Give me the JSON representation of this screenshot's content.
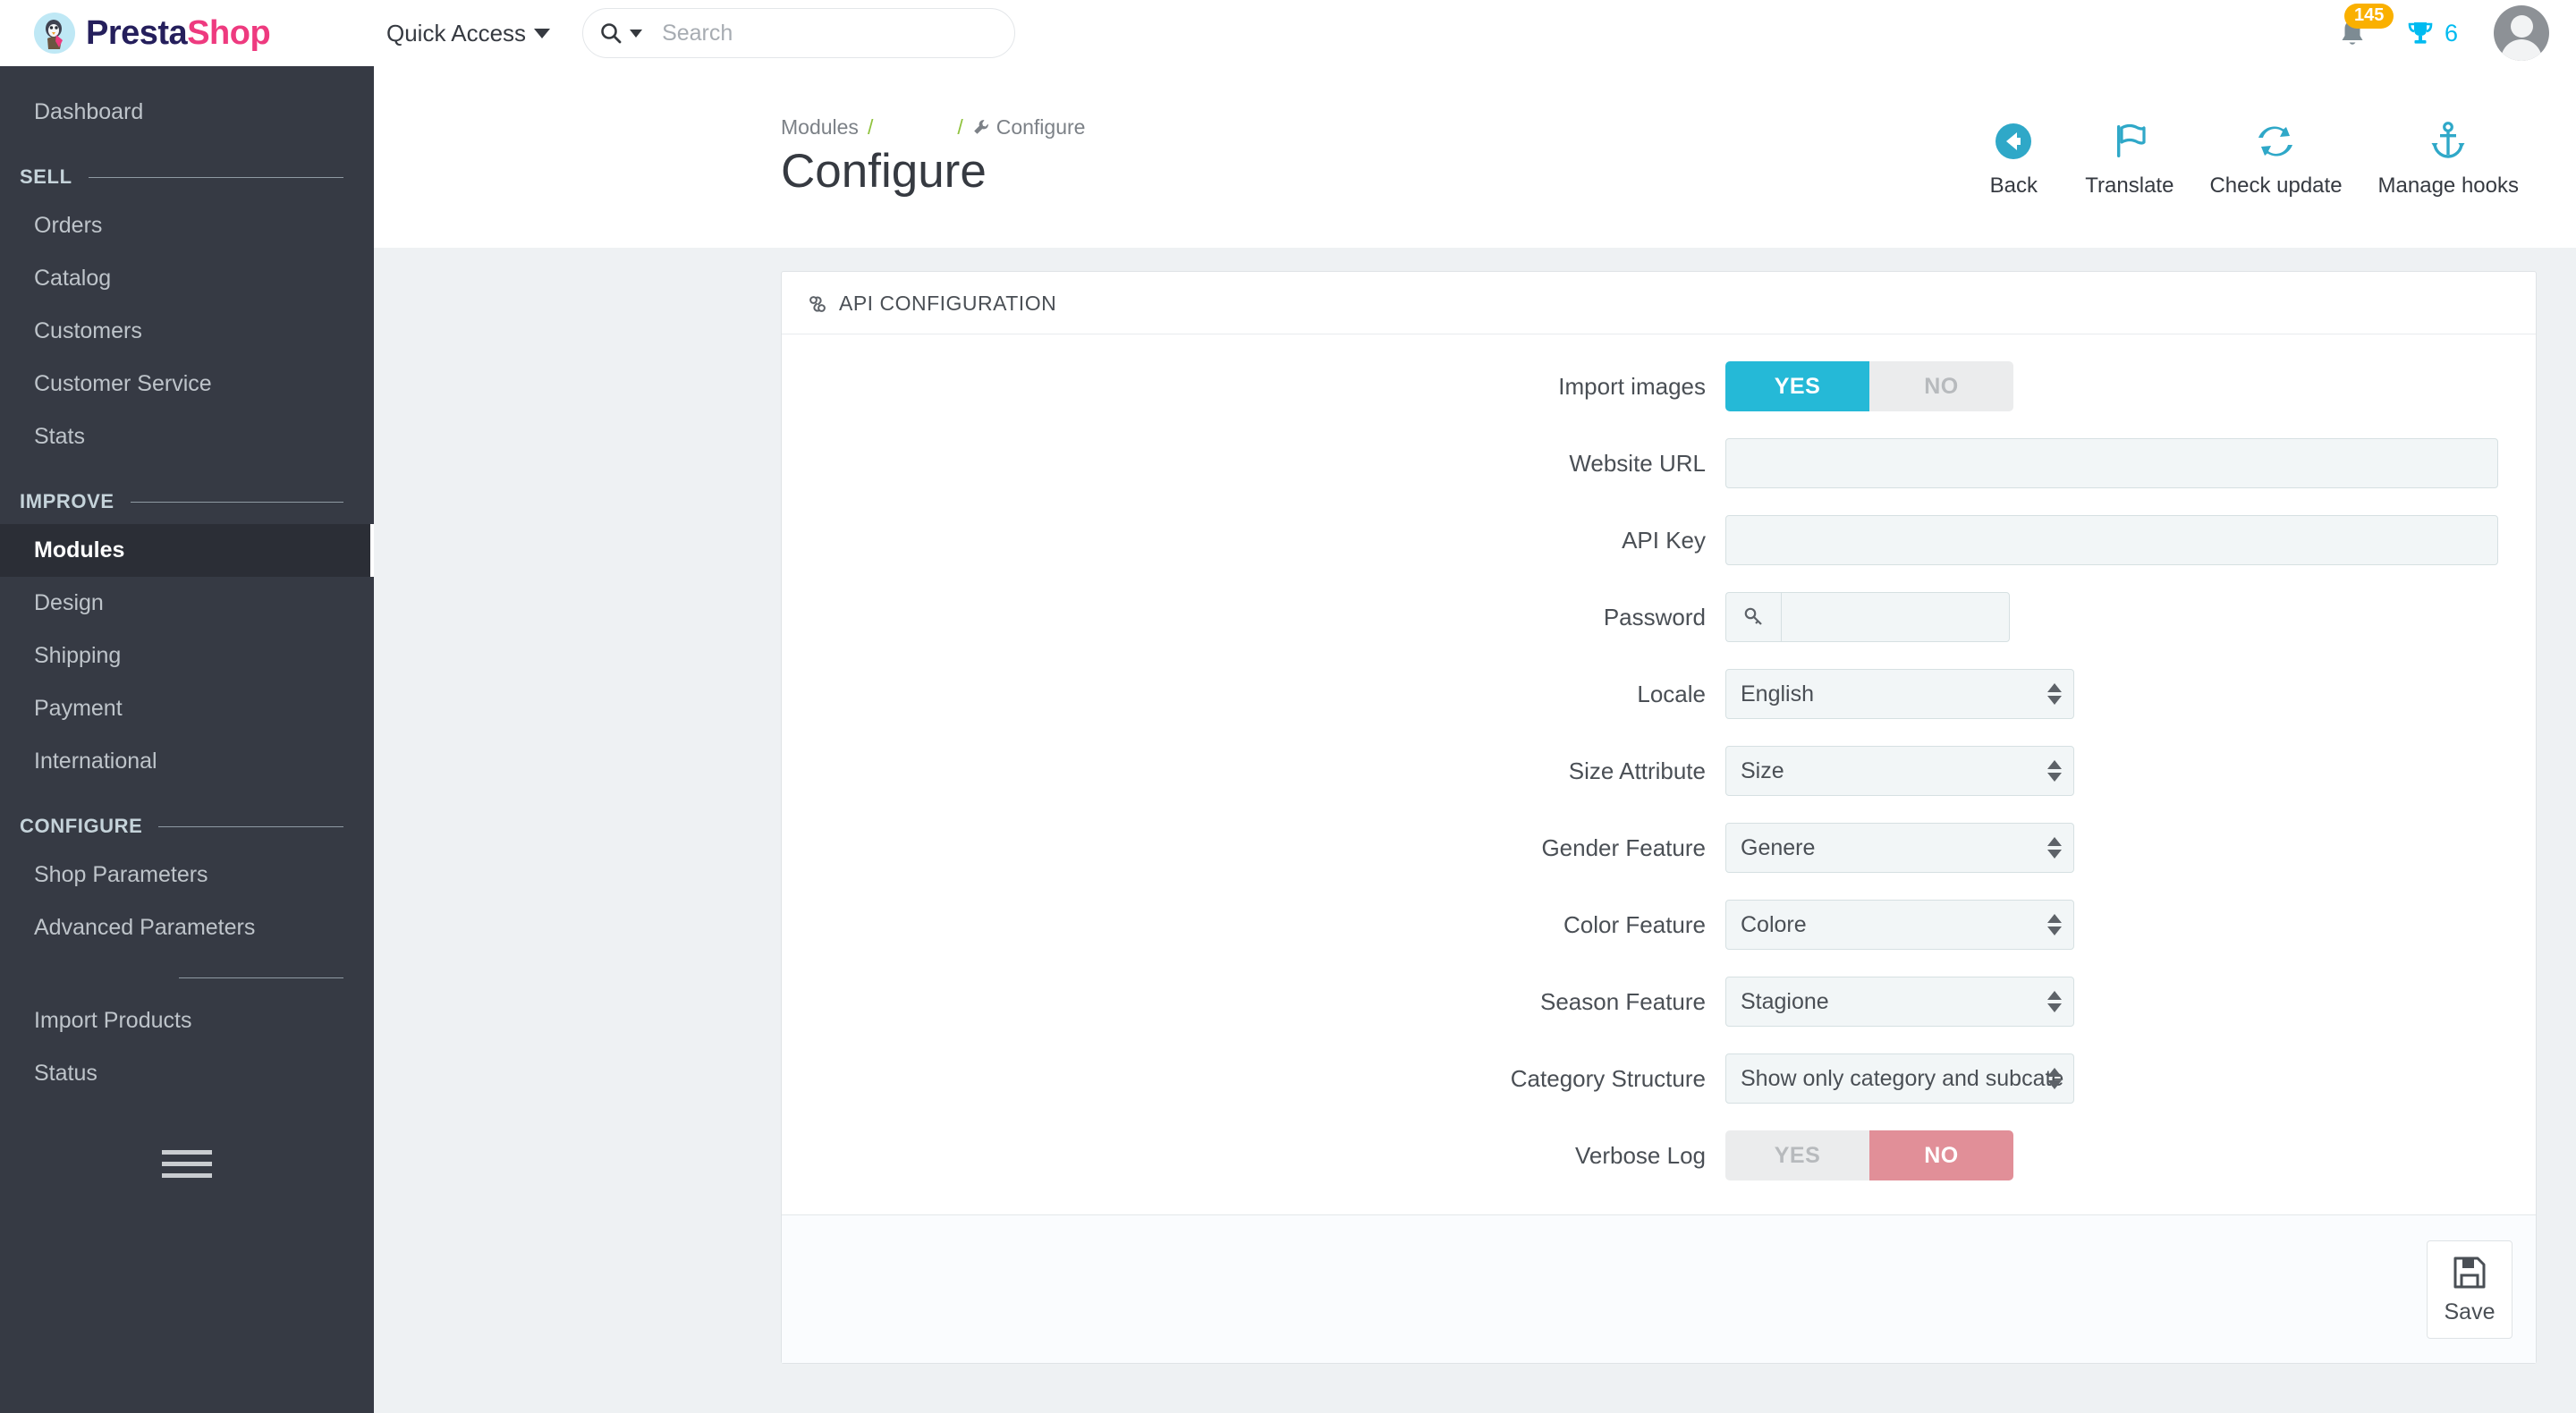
{
  "brand": {
    "part1": "Presta",
    "part2": "Shop",
    "logo_icon": "prestashop-logo-icon"
  },
  "header": {
    "quick_access_label": "Quick Access",
    "search": {
      "placeholder": "Search",
      "value": "",
      "icon": "search-icon",
      "dropdown_icon": "chevron-down-icon"
    },
    "notifications": {
      "icon": "bell-icon",
      "count": "145"
    },
    "achievements": {
      "icon": "trophy-icon",
      "count": "6"
    },
    "avatar": {
      "icon": "avatar-icon"
    }
  },
  "sidebar": {
    "dashboard": "Dashboard",
    "sections": [
      {
        "title": "SELL",
        "items": [
          "Orders",
          "Catalog",
          "Customers",
          "Customer Service",
          "Stats"
        ]
      },
      {
        "title": "IMPROVE",
        "items": [
          "Modules",
          "Design",
          "Shipping",
          "Payment",
          "International"
        ]
      },
      {
        "title": "CONFIGURE",
        "items": [
          "Shop Parameters",
          "Advanced Parameters"
        ]
      }
    ],
    "extra_items": [
      "Import Products",
      "Status"
    ],
    "active_item": "Modules",
    "collapse_icon": "hamburger-menu-icon"
  },
  "page": {
    "breadcrumb": {
      "root": "Modules",
      "sep": "/",
      "current": "Configure",
      "current_icon": "wrench-icon"
    },
    "title": "Configure"
  },
  "toolbar": [
    {
      "label": "Back",
      "icon": "arrow-circle-left-icon"
    },
    {
      "label": "Translate",
      "icon": "flag-icon"
    },
    {
      "label": "Check update",
      "icon": "refresh-sync-icon"
    },
    {
      "label": "Manage hooks",
      "icon": "anchor-icon"
    }
  ],
  "panel": {
    "title": "API CONFIGURATION",
    "icon": "link-chain-icon",
    "fields": [
      {
        "label": "Import images",
        "type": "switch",
        "yes": "YES",
        "no": "NO",
        "value": "YES"
      },
      {
        "label": "Website URL",
        "type": "text",
        "value": "",
        "placeholder": ""
      },
      {
        "label": "API Key",
        "type": "text",
        "value": "",
        "placeholder": ""
      },
      {
        "label": "Password",
        "type": "password",
        "value": "",
        "placeholder": "",
        "addon_icon": "key-icon"
      },
      {
        "label": "Locale",
        "type": "select",
        "value": "English"
      },
      {
        "label": "Size Attribute",
        "type": "select",
        "value": "Size"
      },
      {
        "label": "Gender Feature",
        "type": "select",
        "value": "Genere"
      },
      {
        "label": "Color Feature",
        "type": "select",
        "value": "Colore"
      },
      {
        "label": "Season Feature",
        "type": "select",
        "value": "Stagione"
      },
      {
        "label": "Category Structure",
        "type": "select",
        "value": "Show only category and subcate"
      },
      {
        "label": "Verbose Log",
        "type": "switch",
        "yes": "YES",
        "no": "NO",
        "value": "NO"
      }
    ],
    "save": {
      "label": "Save",
      "icon": "floppy-save-icon"
    }
  },
  "colors": {
    "accent_teal": "#25b9d7",
    "accent_pink": "#ee3a7f",
    "brand_navy": "#251f5c",
    "badge_amber": "#fab000",
    "danger_red": "#e18f98",
    "sidebar_bg": "#363a44",
    "toolbar_icon": "#2fa8c8"
  }
}
